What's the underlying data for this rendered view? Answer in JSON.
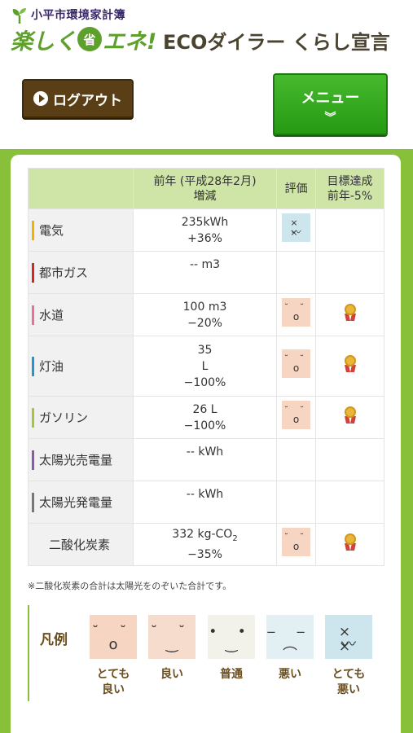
{
  "header": {
    "city_title": "小平市環境家計簿",
    "logo_part1": "楽しく",
    "logo_sho": "省",
    "logo_part2": "エネ!",
    "logo_sub": "ECOダイラー くらし宣言"
  },
  "buttons": {
    "logout_label": "ログアウト",
    "menu_label": "メニュー",
    "menu_chevron": "︾"
  },
  "table": {
    "headers": {
      "change": "前年 (平成28年2月)",
      "change2": "増減",
      "rating": "評価",
      "goal": "目標達成",
      "goal2": "前年-5%"
    },
    "rows": [
      {
        "category": "電気",
        "bar_color": "#f0b400",
        "line1": "235kWh",
        "line2": "+36%",
        "line3": "",
        "rating": "very_bad",
        "rating_eyes": "× ×",
        "rating_mouth": "〰",
        "rating_bg": "#cde6ee",
        "goal_achieved": false
      },
      {
        "category": "都市ガス",
        "bar_color": "#d7261f",
        "line1": "-- m3",
        "line2": "",
        "line3": "",
        "rating": "",
        "goal_achieved": false
      },
      {
        "category": "水道",
        "bar_color": "#e8709c",
        "line1": "100 m3",
        "line2": "−20%",
        "line3": "",
        "rating": "very_good",
        "rating_eyes": "˘ ˘",
        "rating_mouth": "o",
        "rating_bg": "#f6d5c2",
        "goal_achieved": true
      },
      {
        "category": "灯油",
        "bar_color": "#2496d0",
        "line1": "35",
        "line2": "L",
        "line3": "−100%",
        "rating": "very_good",
        "rating_eyes": "˘ ˘",
        "rating_mouth": "o",
        "rating_bg": "#f6d5c2",
        "goal_achieved": true
      },
      {
        "category": "ガソリン",
        "bar_color": "#a5c63a",
        "line1": "26 L",
        "line2": "−100%",
        "line3": "",
        "rating": "very_good",
        "rating_eyes": "˘ ˘",
        "rating_mouth": "o",
        "rating_bg": "#f6d5c2",
        "goal_achieved": true
      },
      {
        "category": "太陽光売電量",
        "bar_color": "#8a5aa6",
        "line1": "-- kWh",
        "line2": "",
        "line3": "",
        "rating": "",
        "goal_achieved": false
      },
      {
        "category": "太陽光発電量",
        "bar_color": "#777777",
        "line1": "-- kWh",
        "line2": "",
        "line3": "",
        "rating": "",
        "goal_achieved": false
      },
      {
        "category": "二酸化炭素",
        "bar_color": "",
        "line1": "332 kg-CO",
        "line1_sub": "2",
        "line2": "−35%",
        "line3": "",
        "rating": "very_good",
        "rating_eyes": "˘ ˘",
        "rating_mouth": "o",
        "rating_bg": "#f6d5c2",
        "goal_achieved": true
      }
    ]
  },
  "footnote": "※二酸化炭素の合計は太陽光をのぞいた合計です。",
  "legend": {
    "title": "凡例",
    "items": [
      {
        "label": "とても良い",
        "line1": "とても",
        "line2": "良い",
        "eyes": "˘ ˘",
        "mouth": "o",
        "bg": "#f6d5c2"
      },
      {
        "label": "良い",
        "line1": "良い",
        "line2": "",
        "eyes": "˘ ˘",
        "mouth": "‿",
        "bg": "#f6dccc"
      },
      {
        "label": "普通",
        "line1": "普通",
        "line2": "",
        "eyes": "• •",
        "mouth": "‿",
        "bg": "#f3f2ea"
      },
      {
        "label": "悪い",
        "line1": "悪い",
        "line2": "",
        "eyes": "‒ ‒",
        "mouth": "︵",
        "bg": "#e2eff3"
      },
      {
        "label": "とても悪い",
        "line1": "とても",
        "line2": "悪い",
        "eyes": "× ×",
        "mouth": "〰",
        "bg": "#cde6ee"
      }
    ]
  },
  "colors": {
    "brand_green": "#88c03a",
    "menu_green": "#259a12",
    "logout_brown": "#5a3f16"
  }
}
